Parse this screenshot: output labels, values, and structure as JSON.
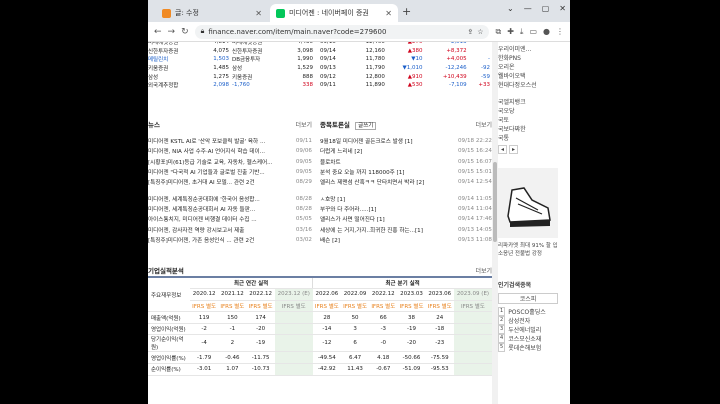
{
  "browser": {
    "tabs": [
      {
        "label": "글: 수정",
        "active": false
      },
      {
        "label": "미디어젠 : 네이버페이 증권",
        "active": true
      }
    ],
    "new_tab": "+",
    "url": "finance.naver.com/item/main.naver?code=279600"
  },
  "peers": [
    {
      "a": "미래에셋증권",
      "b": "4,814",
      "c": "미래에셋증권",
      "d": "4,430"
    },
    {
      "a": "신한투자증권",
      "b": "4,075",
      "c": "신한투자증권",
      "d": "3,098"
    },
    {
      "a": "메릴린치",
      "b": "1,503",
      "c": "DB금융투자",
      "d": "1,990"
    },
    {
      "a": "키움증권",
      "b": "1,485",
      "c": "삼성",
      "d": "1,529"
    },
    {
      "a": "삼성",
      "b": "1,275",
      "c": "키움증권",
      "d": "888"
    },
    {
      "a": "외국계추정합",
      "b": "2,098",
      "c": "-1,760",
      "d": "338"
    }
  ],
  "daily": [
    {
      "date": "09/15",
      "price": "12,400",
      "chg": "▲270",
      "vol": "-2,513",
      "x": ""
    },
    {
      "date": "09/14",
      "price": "12,160",
      "chg": "▲380",
      "vol": "+8,372",
      "x": ""
    },
    {
      "date": "09/14",
      "price": "11,780",
      "chg": "▼10",
      "vol": "+4,005",
      "x": "-"
    },
    {
      "date": "09/13",
      "price": "11,790",
      "chg": "▼1,010",
      "vol": "-12,246",
      "x": "-92"
    },
    {
      "date": "09/12",
      "price": "12,800",
      "chg": "▲910",
      "vol": "+10,439",
      "x": "-59"
    },
    {
      "date": "09/11",
      "price": "11,890",
      "chg": "▲530",
      "vol": "-7,109",
      "x": "+33"
    }
  ],
  "news": {
    "title": "뉴스",
    "more": "더보기",
    "items": [
      {
        "t": "미디어젠 KSTL AI로 '산악 포보클릭 발굴' 육하 ...",
        "d": "09/11"
      },
      {
        "t": "미디어젠, NIA 사업 수주·AI 언어지식 학습 데이...",
        "d": "09/06"
      },
      {
        "t": "[시황포]미(61)등급 기술로 교육, 자동차, 헬스케어...",
        "d": "09/05"
      },
      {
        "t": "미디어젠 \"다국적 AI 기업들과 글로벌 진출 기반...",
        "d": "09/05"
      },
      {
        "t": "[특징주]미디어젠, 초거대 AI 모델...  관련 2건",
        "d": "08/29"
      },
      {
        "t": "미디어젠, 세계특징순공대회에 '한국어 음성합...",
        "d": "08/28"
      },
      {
        "t": "미디어젠, 세계특징순공대회서 AI 자동 들판...",
        "d": "08/28"
      },
      {
        "t": "아이스통치지, 미디어젠 비행결 데이터 수집 ...",
        "d": "05/05"
      },
      {
        "t": "미디어젠, 감사자전 역량 강시보고서 제출",
        "d": "03/16"
      },
      {
        "t": "[특징주]미디어젠, 가존 음성인식 ...  관련 2건",
        "d": "03/02"
      }
    ]
  },
  "board": {
    "title": "종목토론실",
    "write": "글쓰기",
    "more": "더보기",
    "items": [
      {
        "t": "9월18일 미디어젠 골든크로스 발생 [1]",
        "d": "09/18 22:22"
      },
      {
        "t": "더럽게 느리네 [2]",
        "d": "09/15 16:24"
      },
      {
        "t": "블로차트",
        "d": "09/15 16:07"
      },
      {
        "t": "분석 중요 오늘 까지 118000주 [1]",
        "d": "09/15 15:01"
      },
      {
        "t": "엘리스 제맨섬 산혹ㅋㅋ 단타치면서 박라 [2]",
        "d": "09/14 12:54"
      },
      {
        "t": "ㅅ호망 [1]",
        "d": "09/14 11:05"
      },
      {
        "t": "부꾸와 다 주어라.....[1]",
        "d": "09/14 11:04"
      },
      {
        "t": "앨리스가 사면 떨어진다 [1]",
        "d": "09/14 17:46"
      },
      {
        "t": "세상에 는 거지,가지..희귀한 진홍 하는...[1]",
        "d": "09/13 14:05"
      },
      {
        "t": "배슨 [2]",
        "d": "09/13 11:08"
      }
    ]
  },
  "finance": {
    "title": "기업실적분석",
    "more": "더보기",
    "annual_h": "최근 연간 실적",
    "quarter_h": "최근 분기 실적",
    "row_h": "주요재무정보",
    "periods": [
      "2020.12",
      "2021.12",
      "2022.12",
      "2023.12 (E)",
      "2022.06",
      "2022.09",
      "2022.12",
      "2023.03",
      "2023.06",
      "2023.09 (E)"
    ],
    "ifrs": "IFRS 별도",
    "rows": [
      {
        "label": "매출액(억원)",
        "v": [
          "119",
          "150",
          "174",
          "",
          "28",
          "50",
          "66",
          "38",
          "24",
          ""
        ]
      },
      {
        "label": "영업이익(억원)",
        "v": [
          "-2",
          "-1",
          "-20",
          "",
          "-14",
          "3",
          "-3",
          "-19",
          "-18",
          ""
        ]
      },
      {
        "label": "당기순이익(억원)",
        "v": [
          "-4",
          "2",
          "-19",
          "",
          "-12",
          "6",
          "-0",
          "-20",
          "-23",
          ""
        ]
      },
      {
        "label": "영업이익률(%)",
        "v": [
          "-1.79",
          "-0.46",
          "-11.75",
          "",
          "-49.54",
          "6.47",
          "4.18",
          "-50.66",
          "-75.59",
          ""
        ]
      },
      {
        "label": "순이익률(%)",
        "v": [
          "-3.01",
          "1.07",
          "-10.73",
          "",
          "-42.92",
          "11.43",
          "-0.67",
          "-51.09",
          "-95.53",
          ""
        ]
      }
    ]
  },
  "side": {
    "brokers": [
      "우리이미엔...",
      "한화PNS",
      "오리온",
      "웰바이오택",
      "현대다정오스선"
    ],
    "themes": [
      "국엘지뱅크",
      "국오당",
      "국토",
      "국보다쨔한",
      "국통"
    ],
    "ad_text": "리파카엣 최대 91% 할 입소응년 전불법 강정",
    "ranking_title": "인기검색종목",
    "ranking_tab": "코스피",
    "ranking": [
      "POSCO홀딩스",
      "삼성전자",
      "두산에너빌리",
      "코스모신소재",
      "롯데손해보험"
    ]
  }
}
